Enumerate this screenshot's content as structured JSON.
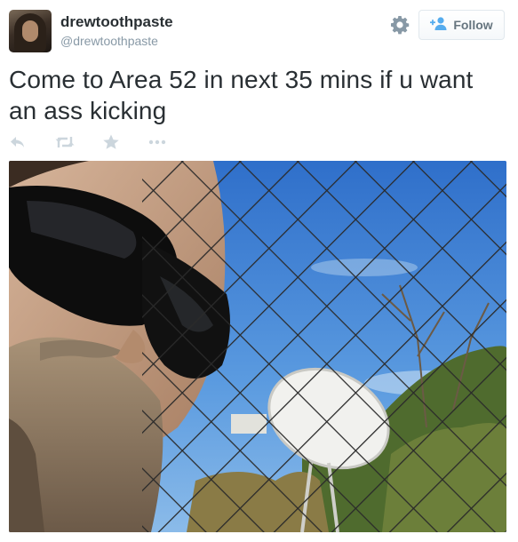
{
  "user": {
    "display_name": "drewtoothpaste",
    "handle": "@drewtoothpaste"
  },
  "follow_button": {
    "label": "Follow"
  },
  "tweet": {
    "text": "Come to Area 52 in next 35 mins if u want an ass kicking"
  },
  "icons": {
    "settings": "gear-icon",
    "follow": "add-user-icon",
    "reply": "reply-icon",
    "retweet": "retweet-icon",
    "favorite": "star-icon",
    "more": "more-icon"
  },
  "colors": {
    "text": "#292f33",
    "secondary": "#8899a6",
    "action_icons": "#ccd6dd",
    "follow_accent": "#55acee"
  }
}
